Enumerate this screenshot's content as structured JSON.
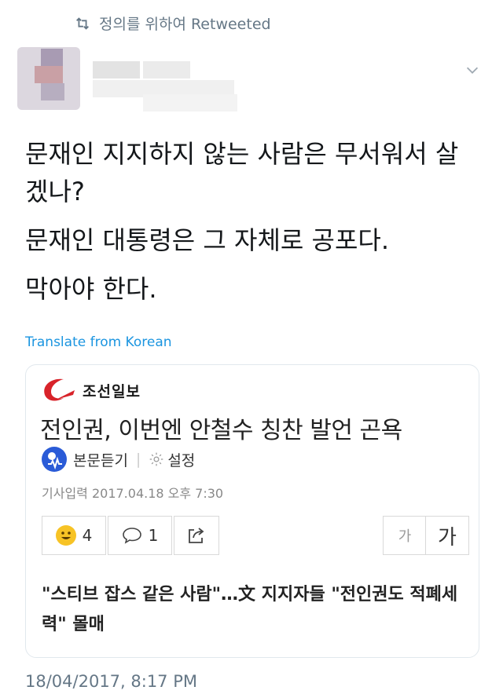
{
  "retweet": {
    "label": "정의를 위하여 Retweeted"
  },
  "tweet": {
    "lines": [
      "문재인 지지하지 않는 사람은 무서워서 살겠나?",
      "문재인 대통령은 그 자체로 공포다.",
      "막아야 한다."
    ],
    "translate_label": "Translate from Korean",
    "timestamp": "18/04/2017, 8:17 PM"
  },
  "card": {
    "brand": "조선일보",
    "headline": "전인권, 이번엔 안철수 칭찬 발언 곤욕",
    "listen_label": "본문듣기",
    "settings_label": "설정",
    "dateline": "기사입력 2017.04.18 오후 7:30",
    "reaction_count": "4",
    "comment_count": "1",
    "font_small": "가",
    "font_large": "가",
    "article_text": "\"스티브 잡스 같은 사람\"…文 지지자들 \"전인권도 적폐세력\" 몰매"
  },
  "colors": {
    "link": "#1b95e0",
    "muted": "#657786",
    "brand_red": "#d8232a",
    "border": "#e1e8ed"
  }
}
